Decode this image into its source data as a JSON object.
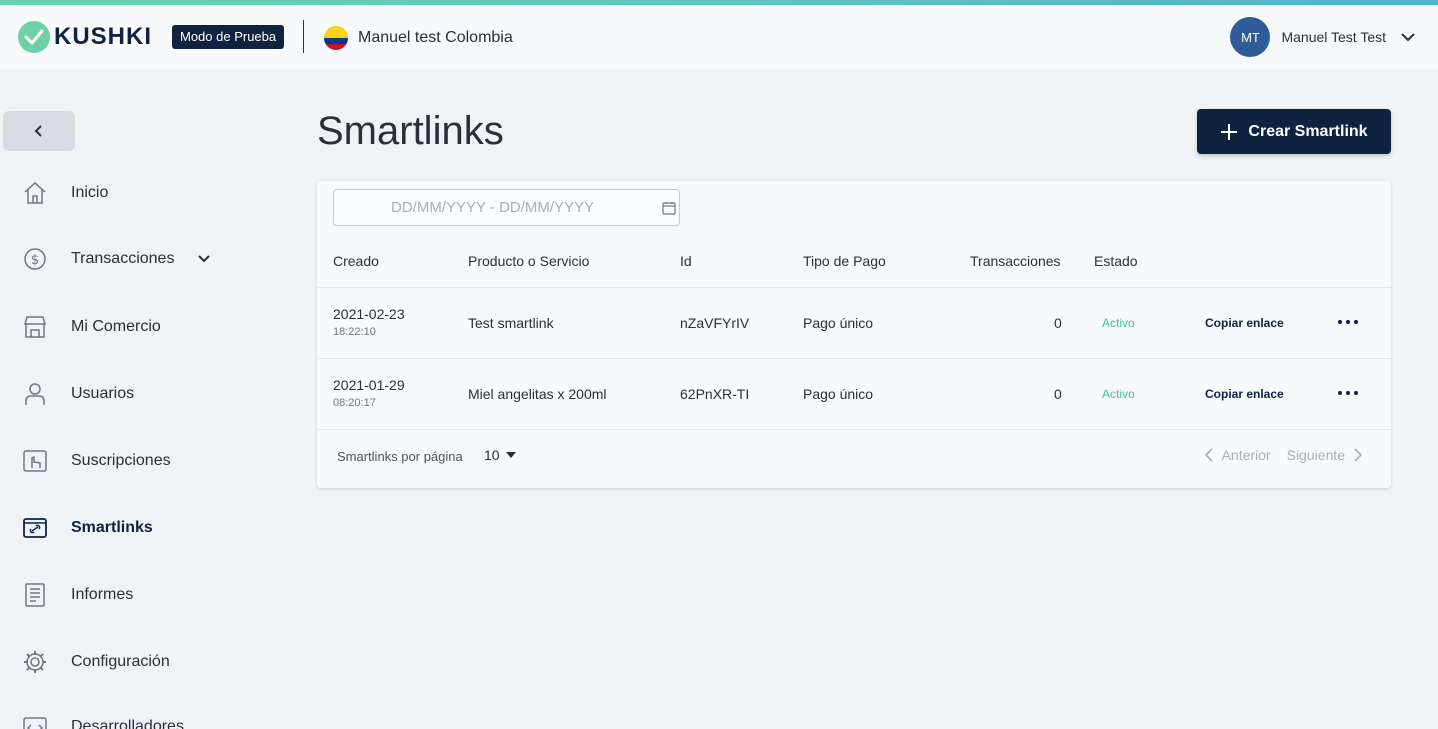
{
  "header": {
    "brand": "KUSHKI",
    "mode_badge": "Modo de Prueba",
    "merchant_name": "Manuel test Colombia",
    "user_initials": "MT",
    "user_name": "Manuel Test Test"
  },
  "sidebar": {
    "items": [
      {
        "label": "Inicio",
        "icon": "home-icon"
      },
      {
        "label": "Transacciones",
        "icon": "dollar-circle-icon"
      },
      {
        "label": "Mi Comercio",
        "icon": "store-icon"
      },
      {
        "label": "Usuarios",
        "icon": "user-icon"
      },
      {
        "label": "Suscripciones",
        "icon": "subscription-icon"
      },
      {
        "label": "Smartlinks",
        "icon": "link-icon"
      },
      {
        "label": "Informes",
        "icon": "report-icon"
      },
      {
        "label": "Configuración",
        "icon": "gear-icon"
      },
      {
        "label": "Desarrolladores",
        "icon": "code-icon"
      }
    ]
  },
  "main": {
    "title": "Smartlinks",
    "create_button": "Crear Smartlink",
    "date_placeholder": "DD/MM/YYYY - DD/MM/YYYY",
    "columns": [
      "Creado",
      "Producto o Servicio",
      "Id",
      "Tipo de Pago",
      "Transacciones",
      "Estado"
    ],
    "rows": [
      {
        "date": "2021-02-23",
        "time": "18:22:10",
        "product": "Test smartlink",
        "id": "nZaVFYrIV",
        "payment_type": "Pago único",
        "transactions": "0",
        "status": "Activo",
        "copy": "Copiar enlace"
      },
      {
        "date": "2021-01-29",
        "time": "08:20:17",
        "product": "Miel angelitas x 200ml",
        "id": "62PnXR-TI",
        "payment_type": "Pago único",
        "transactions": "0",
        "status": "Activo",
        "copy": "Copiar enlace"
      }
    ],
    "per_page_label": "Smartlinks por página",
    "per_page_value": "10",
    "prev_label": "Anterior",
    "next_label": "Siguiente"
  },
  "colors": {
    "brand_navy": "#0f2341",
    "status_active": "#3fc39b",
    "logo_green": "#6ed1a4"
  }
}
